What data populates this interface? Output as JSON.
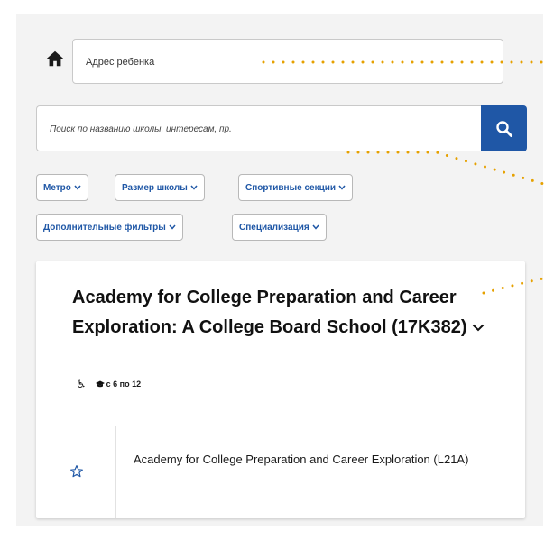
{
  "address": {
    "placeholder": "Адрес ребенка"
  },
  "search": {
    "placeholder": "Поиск по названию школы, интересам, пр."
  },
  "filters": [
    {
      "label": "Метро"
    },
    {
      "label": "Размер школы"
    },
    {
      "label": "Спортивные секции"
    },
    {
      "label": "Дополнительные фильтры"
    },
    {
      "label": "Специализация"
    }
  ],
  "school": {
    "title": "Academy for College Preparation and Career Exploration: A College Board School (17K382)",
    "grades": "с 6 по 12",
    "program": "Academy for College Preparation and Career Exploration (L21A)"
  },
  "colors": {
    "accent": "#1f57a6",
    "annotation": "#e6a100"
  },
  "icons": [
    "home-icon",
    "search-icon",
    "chevron-down-icon",
    "wheelchair-icon",
    "graduation-cap-icon",
    "star-icon"
  ]
}
